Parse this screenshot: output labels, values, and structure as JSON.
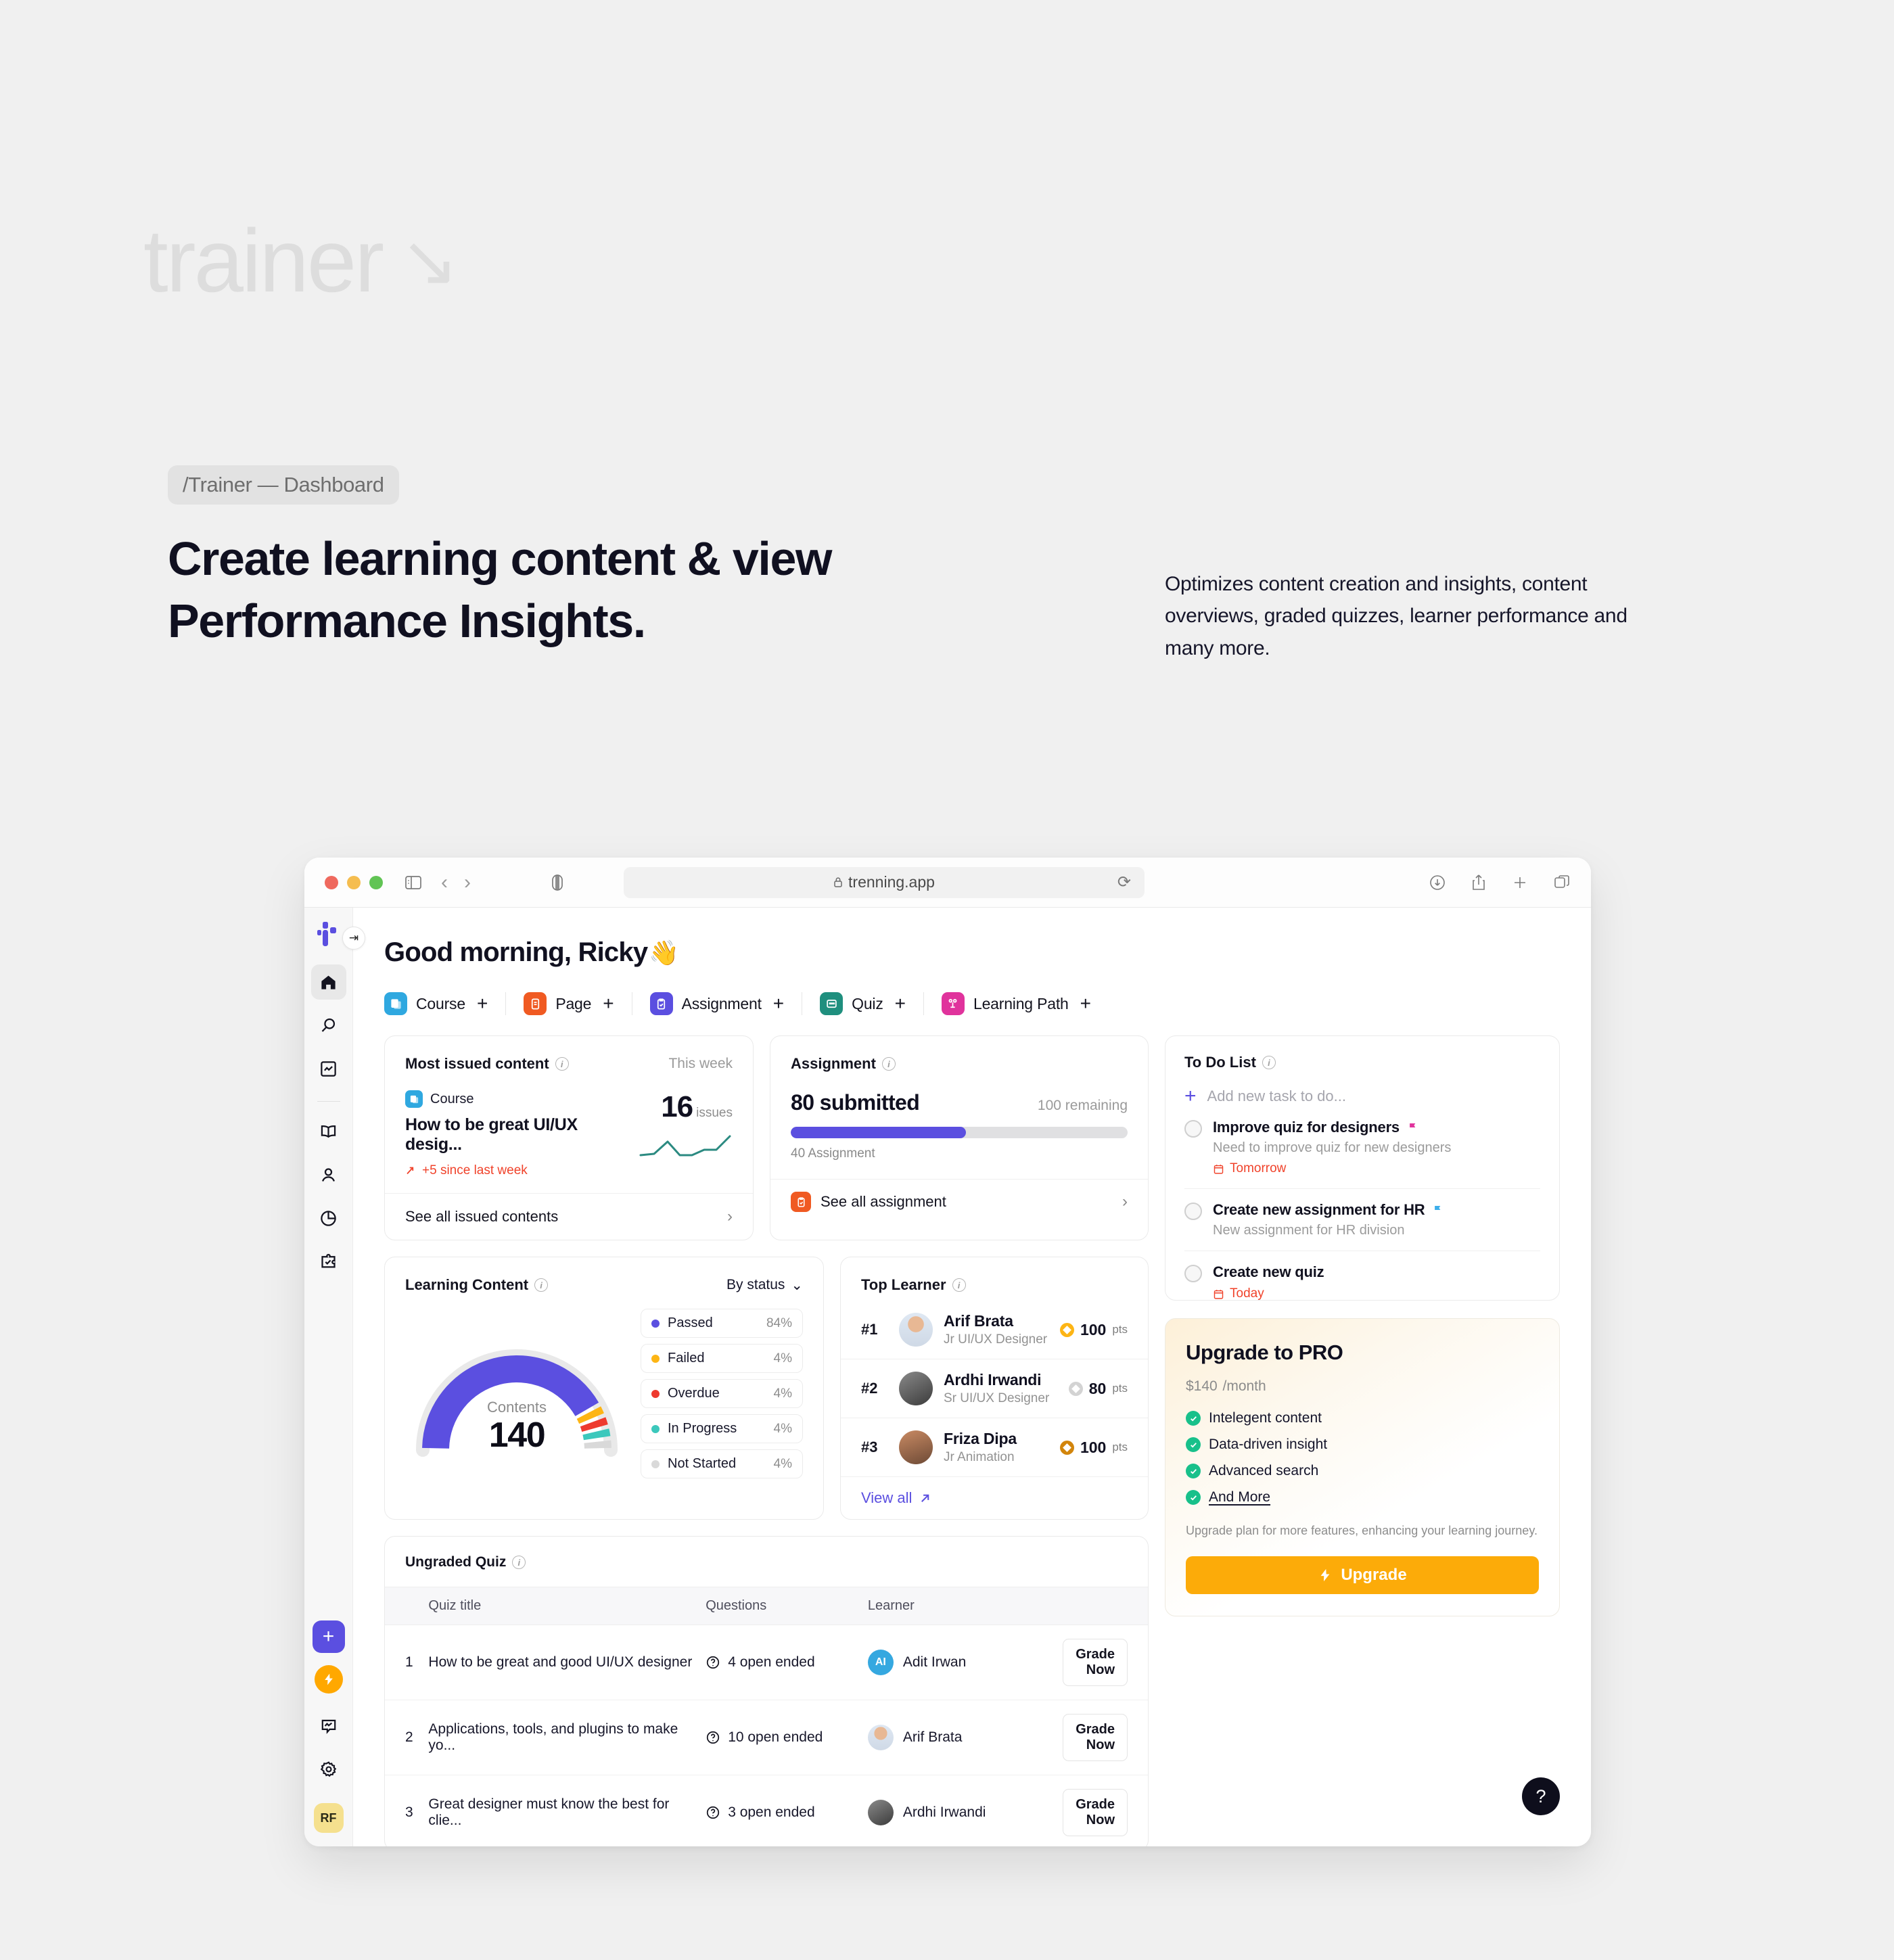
{
  "hero": {
    "wordmark": "trainer",
    "wordmark_arrow": "↘",
    "breadcrumb": "/Trainer — Dashboard",
    "headline": "Create learning content & view Performance Insights.",
    "subcopy": "Optimizes content creation and insights, content overviews, graded quizzes, learner performance and many more."
  },
  "browser": {
    "url": "trenning.app",
    "lock_icon": "lock-icon",
    "reload_icon": "reload-icon",
    "sidebar_toggle_icon": "sidebar-toggle-icon",
    "back_icon": "chevron-left-icon",
    "forward_icon": "chevron-right-icon",
    "reader_icon": "reader-view-icon",
    "downloads_icon": "downloads-icon",
    "share_icon": "share-icon",
    "newtab_icon": "plus-icon",
    "tabs_icon": "tab-overview-icon"
  },
  "sidebar": {
    "brand": "trenning-logo",
    "collapse_icon": "collapse-panel-icon",
    "items": [
      {
        "name": "home",
        "icon": "home-icon",
        "active": true
      },
      {
        "name": "search",
        "icon": "search-icon",
        "active": false
      },
      {
        "name": "analytics",
        "icon": "chart-box-icon",
        "active": false
      },
      {
        "name": "library",
        "icon": "book-open-icon",
        "active": false
      },
      {
        "name": "learners",
        "icon": "user-icon",
        "active": false
      },
      {
        "name": "reports",
        "icon": "pie-chart-icon",
        "active": false
      },
      {
        "name": "integrations",
        "icon": "puzzle-check-icon",
        "active": false
      }
    ],
    "bottom": {
      "add_label": "+",
      "bolt_icon": "bolt-icon",
      "feedback_icon": "feedback-chat-icon",
      "settings_icon": "gear-icon",
      "avatar_initials": "RF"
    }
  },
  "main": {
    "greeting": "Good morning, Ricky",
    "greeting_emoji": "👋",
    "create_items": [
      {
        "label": "Course",
        "icon": "course-icon",
        "color": "#2FA8E0",
        "plus": "+"
      },
      {
        "label": "Page",
        "icon": "page-icon",
        "color": "#F05A22",
        "plus": "+"
      },
      {
        "label": "Assignment",
        "icon": "assignment-icon",
        "color": "#5B4FE0",
        "plus": "+"
      },
      {
        "label": "Quiz",
        "icon": "quiz-icon",
        "color": "#1F8F7E",
        "plus": "+"
      },
      {
        "label": "Learning Path",
        "icon": "learning-path-icon",
        "color": "#E0339C",
        "plus": "+"
      }
    ]
  },
  "most_issued": {
    "title": "Most issued content",
    "period": "This week",
    "type_label": "Course",
    "type_icon": "course-icon",
    "content_title": "How to be great UI/UX desig...",
    "trend": "+5 since last week",
    "trend_icon": "trend-up-icon",
    "count": "16",
    "count_unit": "issues",
    "footer": "See all issued contents",
    "chevron": "›"
  },
  "assignment": {
    "title": "Assignment",
    "submitted": "80 submitted",
    "remaining": "100 remaining",
    "progress_percent": 52,
    "count": "40 Assignment",
    "footer": "See all assignment",
    "footer_icon": "assignment-icon",
    "chevron": "›"
  },
  "learning_content": {
    "title": "Learning Content",
    "filter": "By status",
    "filter_chevron": "⌄",
    "gauge_label": "Contents",
    "gauge_value": "140"
  },
  "chart_data": {
    "type": "pie",
    "title": "Learning Content",
    "subtitle": "By status",
    "center_label": "Contents",
    "center_value": 140,
    "legend_position": "right",
    "categories": [
      "Passed",
      "Failed",
      "Overdue",
      "In Progress",
      "Not Started"
    ],
    "values": [
      84,
      4,
      4,
      4,
      4
    ],
    "value_labels": [
      "84%",
      "4%",
      "4%",
      "4%",
      "4%"
    ],
    "colors": [
      "#5B4FE0",
      "#FDB515",
      "#EE3A2E",
      "#3CC8BC",
      "#D9D9D9"
    ]
  },
  "top_learner": {
    "title": "Top Learner",
    "view_all": "View all",
    "view_all_icon": "arrow-up-right-icon",
    "rows": [
      {
        "rank": "#1",
        "name": "Arif Brata",
        "role": "Jr UI/UX Designer",
        "points": "100",
        "unit": "pts",
        "medal": "#FDB515"
      },
      {
        "rank": "#2",
        "name": "Ardhi Irwandi",
        "role": "Sr UI/UX Designer",
        "points": "80",
        "unit": "pts",
        "medal": "#D3D3D3"
      },
      {
        "rank": "#3",
        "name": "Friza Dipa",
        "role": "Jr Animation",
        "points": "100",
        "unit": "pts",
        "medal": "#D2850C"
      }
    ]
  },
  "ungraded_quiz": {
    "title": "Ungraded Quiz",
    "columns": [
      "Quiz title",
      "Questions",
      "Learner"
    ],
    "action_label": "Grade Now",
    "rows": [
      {
        "idx": "1",
        "title": "How to be great and good UI/UX designer",
        "questions": "4 open ended",
        "learner": "Adit Irwan",
        "avatar_initials": "AI"
      },
      {
        "idx": "2",
        "title": "Applications, tools, and plugins to make yo...",
        "questions": "10 open ended",
        "learner": "Arif Brata",
        "avatar_initials": ""
      },
      {
        "idx": "3",
        "title": "Great designer must know the best for clie...",
        "questions": "3 open ended",
        "learner": "Ardhi Irwandi",
        "avatar_initials": ""
      }
    ]
  },
  "todo": {
    "title": "To Do List",
    "add_placeholder": "Add new task to do...",
    "items": [
      {
        "title": "Improve quiz for designers",
        "flag": "#E0339C",
        "desc": "Need to improve quiz for new designers",
        "due": "Tomorrow"
      },
      {
        "title": "Create new assignment for HR",
        "flag": "#3DAEEA",
        "desc": "New assignment for HR division",
        "due": ""
      },
      {
        "title": "Create new quiz",
        "flag": "",
        "desc": "",
        "due": "Today"
      }
    ]
  },
  "pro": {
    "title": "Upgrade to PRO",
    "price": "$140",
    "period": "/month",
    "features": [
      "Intelegent content",
      "Data-driven insight",
      "Advanced search",
      "And More"
    ],
    "note": "Upgrade plan for more features, enhancing your learning journey.",
    "button": "Upgrade",
    "button_icon": "bolt-icon"
  },
  "help": {
    "label": "?"
  }
}
